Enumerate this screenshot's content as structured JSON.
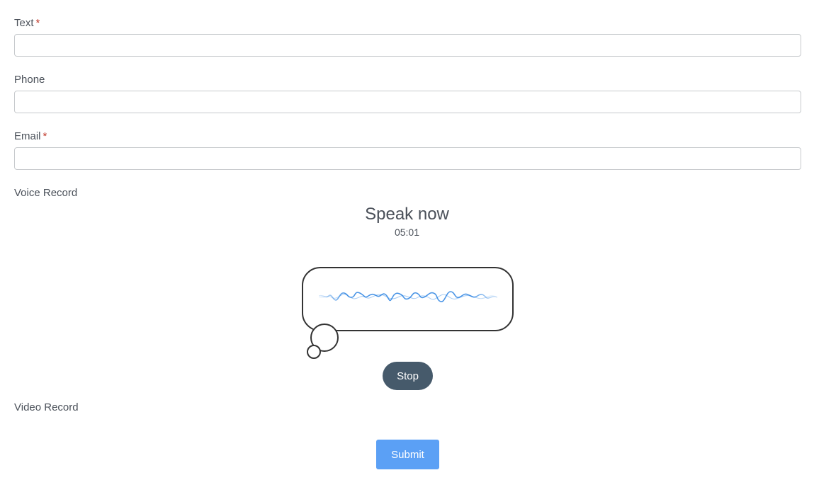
{
  "form": {
    "text": {
      "label": "Text",
      "required_mark": "*",
      "value": "",
      "placeholder": ""
    },
    "phone": {
      "label": "Phone",
      "value": "",
      "placeholder": ""
    },
    "email": {
      "label": "Email",
      "required_mark": "*",
      "value": "",
      "placeholder": ""
    },
    "voice": {
      "label": "Voice Record",
      "status": "Speak now",
      "timer": "05:01",
      "stop_label": "Stop",
      "wave_color": "#1e7be0"
    },
    "video": {
      "label": "Video Record"
    },
    "submit_label": "Submit"
  },
  "colors": {
    "required": "#c0392b",
    "stop_button": "#465a6b",
    "submit_button": "#5ba0f5"
  }
}
